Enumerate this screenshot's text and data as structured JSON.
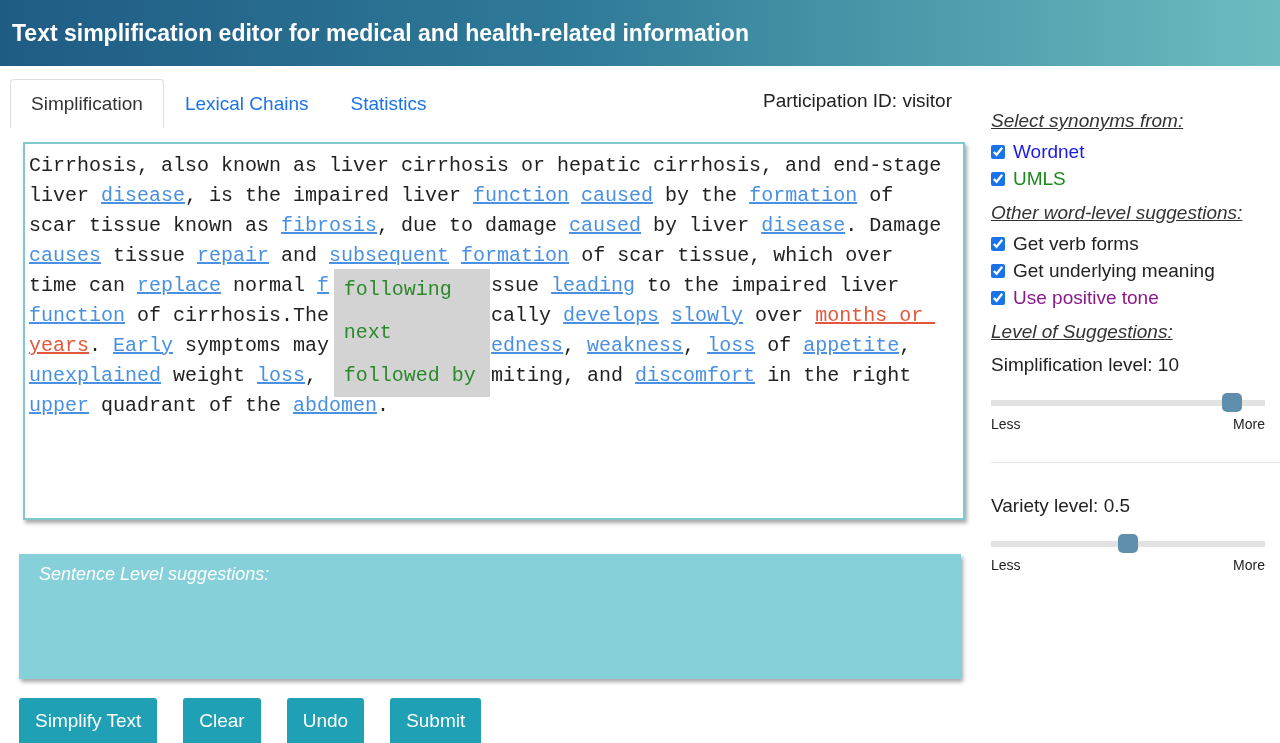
{
  "header": {
    "title": "Text simplification editor for medical and health-related information"
  },
  "tabs": [
    {
      "label": "Simplification",
      "selected": true
    },
    {
      "label": "Lexical Chains",
      "selected": false
    },
    {
      "label": "Statistics",
      "selected": false
    }
  ],
  "participation": "Participation ID: visitor",
  "editor": {
    "lines": [
      {
        "segments": [
          {
            "kind": "plain",
            "text": "Cirrhosis, also known as liver cirrhosis or hepatic cirrhosis, and end-stage"
          }
        ]
      },
      {
        "segments": [
          {
            "kind": "plain",
            "text": "liver "
          },
          {
            "kind": "word",
            "text": "disease"
          },
          {
            "kind": "plain",
            "text": ", is the impaired liver "
          },
          {
            "kind": "word",
            "text": "function",
            "space_after": true
          },
          {
            "kind": "word",
            "text": "caused"
          },
          {
            "kind": "plain",
            "text": " by the "
          },
          {
            "kind": "word",
            "text": "formation"
          },
          {
            "kind": "plain",
            "text": " of"
          }
        ]
      },
      {
        "segments": [
          {
            "kind": "plain",
            "text": "scar tissue known as "
          },
          {
            "kind": "word",
            "text": "fibrosis"
          },
          {
            "kind": "plain",
            "text": ", due to damage "
          },
          {
            "kind": "word",
            "text": "caused"
          },
          {
            "kind": "plain",
            "text": " by liver "
          },
          {
            "kind": "word",
            "text": "disease"
          },
          {
            "kind": "plain",
            "text": ". Damage"
          }
        ]
      },
      {
        "segments": [
          {
            "kind": "word",
            "text": "causes"
          },
          {
            "kind": "plain",
            "text": " tissue "
          },
          {
            "kind": "word",
            "text": "repair"
          },
          {
            "kind": "plain",
            "text": " and "
          },
          {
            "kind": "word",
            "text": "subsequent",
            "space_after": true
          },
          {
            "kind": "word",
            "text": "formation"
          },
          {
            "kind": "plain",
            "text": " of scar tissue, which over"
          }
        ]
      },
      {
        "segments": [
          {
            "kind": "plain",
            "text": "time can "
          },
          {
            "kind": "word",
            "text": "replace"
          },
          {
            "kind": "plain",
            "text": " normal "
          },
          {
            "kind": "word",
            "text": "f"
          }
        ],
        "after_popup": [
          {
            "kind": "plain",
            "text": "ssue "
          },
          {
            "kind": "word",
            "text": "leading"
          },
          {
            "kind": "plain",
            "text": " to the impaired liver"
          }
        ]
      },
      {
        "segments": [
          {
            "kind": "word",
            "text": "function"
          },
          {
            "kind": "plain",
            "text": " of cirrhosis.The"
          }
        ],
        "after_popup": [
          {
            "kind": "plain",
            "text": "cally "
          },
          {
            "kind": "word",
            "text": "develops",
            "space_after": true
          },
          {
            "kind": "word",
            "text": "slowly"
          },
          {
            "kind": "plain",
            "text": " over "
          },
          {
            "kind": "phrase",
            "text": "months or "
          }
        ]
      },
      {
        "segments": [
          {
            "kind": "phrase",
            "text": "years"
          },
          {
            "kind": "plain",
            "text": ". "
          },
          {
            "kind": "word",
            "text": "Early"
          },
          {
            "kind": "plain",
            "text": " symptoms may"
          }
        ],
        "after_popup": [
          {
            "kind": "word",
            "text": "edness"
          },
          {
            "kind": "plain",
            "text": ", "
          },
          {
            "kind": "word",
            "text": "weakness"
          },
          {
            "kind": "plain",
            "text": ", "
          },
          {
            "kind": "word",
            "text": "loss"
          },
          {
            "kind": "plain",
            "text": " of "
          },
          {
            "kind": "word",
            "text": "appetite"
          },
          {
            "kind": "plain",
            "text": ","
          }
        ]
      },
      {
        "segments": [
          {
            "kind": "word",
            "text": "unexplained"
          },
          {
            "kind": "plain",
            "text": " weight "
          },
          {
            "kind": "word",
            "text": "loss"
          },
          {
            "kind": "plain",
            "text": ","
          }
        ],
        "after_popup": [
          {
            "kind": "plain",
            "text": "miting, and "
          },
          {
            "kind": "word",
            "text": "discomfort"
          },
          {
            "kind": "plain",
            "text": " in the right"
          }
        ]
      },
      {
        "segments": [
          {
            "kind": "word",
            "text": "upper"
          },
          {
            "kind": "plain",
            "text": " quadrant of the "
          },
          {
            "kind": "word",
            "text": "abdomen"
          },
          {
            "kind": "plain",
            "text": "."
          }
        ]
      }
    ],
    "popup": {
      "options": [
        "following",
        "next",
        "followed by"
      ]
    }
  },
  "sentence_suggestions": {
    "placeholder": "Sentence Level suggestions:"
  },
  "buttons": [
    "Simplify Text",
    "Clear",
    "Undo",
    "Submit"
  ],
  "sidebar": {
    "synonyms_heading": "Select synonyms from:",
    "synonym_sources": [
      {
        "label": "Wordnet",
        "checked": true,
        "color": "#1a1ae6"
      },
      {
        "label": "UMLS",
        "checked": true,
        "color": "#1a8a1a"
      }
    ],
    "other_heading": "Other word-level suggestions:",
    "other_options": [
      {
        "label": "Get verb forms",
        "checked": true,
        "color": "#222222"
      },
      {
        "label": "Get underlying meaning",
        "checked": true,
        "color": "#222222"
      },
      {
        "label": "Use positive tone",
        "checked": true,
        "color": "#8a1a8a"
      }
    ],
    "level_heading": "Level of Suggestions:",
    "sliders": [
      {
        "label": "Simplification level: 10",
        "level": 0.88,
        "min_label": "Less",
        "max_label": "More"
      },
      {
        "label": "Variety level: 0.5",
        "level": 0.5,
        "min_label": "Less",
        "max_label": "More"
      }
    ]
  }
}
